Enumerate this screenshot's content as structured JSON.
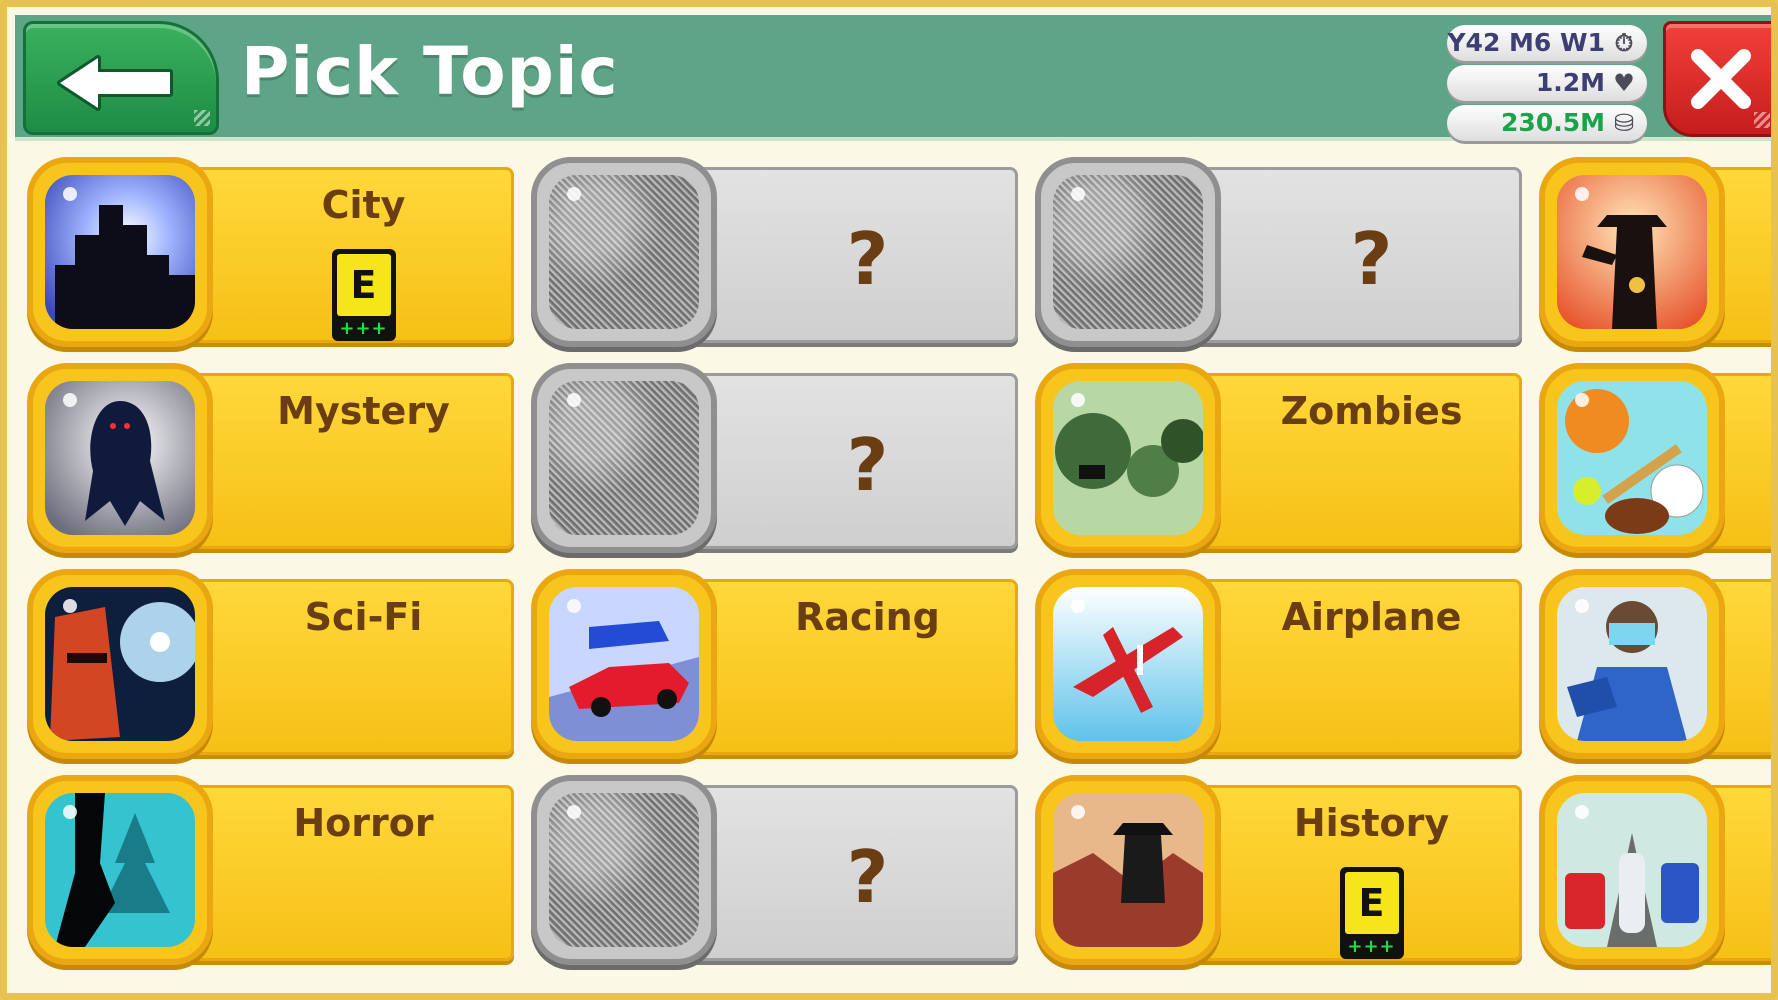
{
  "header": {
    "title": "Pick Topic",
    "date": "Y42 M6 W1",
    "fans": "1.2M",
    "money": "230.5M"
  },
  "colors": {
    "header_bg": "#5ea486",
    "card_unlocked": "#ffd83a",
    "card_locked": "#d6d6d6",
    "topic_text": "#6b3d12",
    "money_text": "#1aa34a",
    "stat_text": "#3d3e72"
  },
  "icons": {
    "back": "arrow-left-icon",
    "close": "close-icon",
    "date": "clock-icon",
    "fans": "heart-icon",
    "money": "coins-icon"
  },
  "topics": [
    [
      {
        "label": "City",
        "locked": false,
        "rating": "E",
        "rating_plus": "+++",
        "icon": "city-skyline-icon"
      },
      {
        "label": "?",
        "locked": true
      },
      {
        "label": "?",
        "locked": true
      },
      {
        "label": "",
        "locked": false,
        "icon": "cowboy-icon"
      }
    ],
    [
      {
        "label": "Mystery",
        "locked": false,
        "icon": "ghost-icon"
      },
      {
        "label": "?",
        "locked": true
      },
      {
        "label": "Zombies",
        "locked": false,
        "icon": "zombie-icon"
      },
      {
        "label": "",
        "locked": false,
        "icon": "sports-balls-icon"
      }
    ],
    [
      {
        "label": "Sci-Fi",
        "locked": false,
        "icon": "robot-icon"
      },
      {
        "label": "Racing",
        "locked": false,
        "icon": "race-car-icon"
      },
      {
        "label": "Airplane",
        "locked": false,
        "icon": "airplane-icon"
      },
      {
        "label": "",
        "locked": false,
        "icon": "surgeon-icon"
      }
    ],
    [
      {
        "label": "Horror",
        "locked": false,
        "icon": "creepy-forest-icon"
      },
      {
        "label": "?",
        "locked": true
      },
      {
        "label": "History",
        "locked": false,
        "rating": "E",
        "rating_plus": "+++",
        "icon": "napoleon-icon"
      },
      {
        "label": "",
        "locked": false,
        "icon": "vehicles-icon"
      }
    ]
  ]
}
